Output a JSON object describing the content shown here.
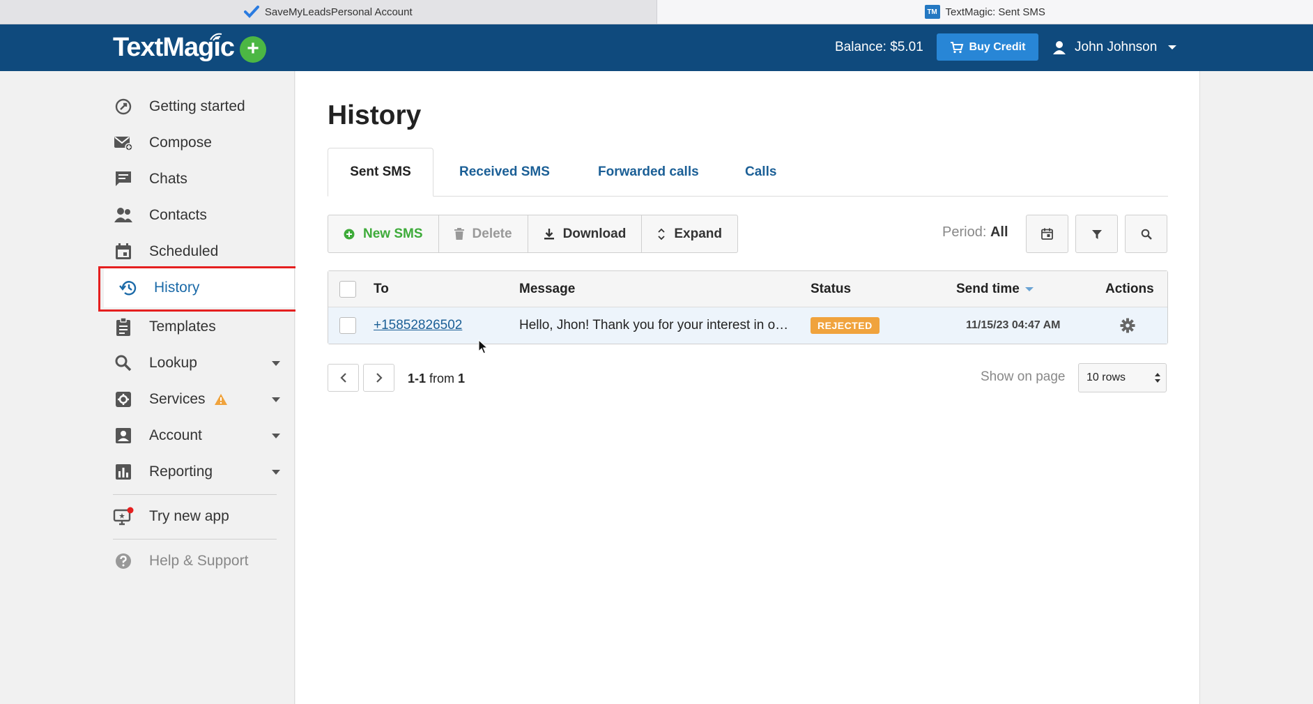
{
  "browser": {
    "tabs": [
      {
        "label": "SaveMyLeadsPersonal Account",
        "favicon": "checkmark-icon"
      },
      {
        "label": "TextMagic: Sent SMS",
        "favicon": "tm-icon",
        "favicon_text": "TM"
      }
    ]
  },
  "header": {
    "logo": "TextMagic",
    "balance": "Balance: $5.01",
    "buy_credit": "Buy Credit",
    "user_name": "John Johnson"
  },
  "sidebar": {
    "items": [
      {
        "label": "Getting started",
        "icon": "rocket-icon"
      },
      {
        "label": "Compose",
        "icon": "compose-icon"
      },
      {
        "label": "Chats",
        "icon": "chat-icon"
      },
      {
        "label": "Contacts",
        "icon": "contacts-icon"
      },
      {
        "label": "Scheduled",
        "icon": "calendar-icon"
      },
      {
        "label": "History",
        "icon": "history-icon",
        "active": true
      },
      {
        "label": "Templates",
        "icon": "clipboard-icon"
      },
      {
        "label": "Lookup",
        "icon": "search-icon",
        "dropdown": true
      },
      {
        "label": "Services",
        "icon": "gear-box-icon",
        "dropdown": true,
        "warning": true
      },
      {
        "label": "Account",
        "icon": "account-icon",
        "dropdown": true
      },
      {
        "label": "Reporting",
        "icon": "bar-chart-icon",
        "dropdown": true
      }
    ],
    "try_new_app": "Try new app",
    "help": "Help & Support"
  },
  "main": {
    "title": "History",
    "tabs": [
      {
        "label": "Sent SMS",
        "active": true
      },
      {
        "label": "Received SMS"
      },
      {
        "label": "Forwarded calls"
      },
      {
        "label": "Calls"
      }
    ],
    "toolbar": {
      "new_sms": "New SMS",
      "delete": "Delete",
      "download": "Download",
      "expand": "Expand"
    },
    "period_label": "Period:",
    "period_value": "All",
    "table": {
      "headers": {
        "to": "To",
        "message": "Message",
        "status": "Status",
        "send_time": "Send time",
        "actions": "Actions"
      },
      "rows": [
        {
          "to": "+15852826502",
          "message": "Hello, Jhon! Thank you for your interest in o…",
          "status": "REJECTED",
          "send_time": "11/15/23 04:47 AM"
        }
      ]
    },
    "pager": {
      "range": "1-1",
      "from_word": "from",
      "total": "1"
    },
    "show_on_page": "Show on page",
    "rows_option": "10 rows"
  },
  "colors": {
    "header_bg": "#0f4a7d",
    "accent_green": "#4cb744",
    "buy_blue": "#2886d6",
    "rejected": "#f0a33d",
    "highlight_red": "#e51f1f"
  }
}
